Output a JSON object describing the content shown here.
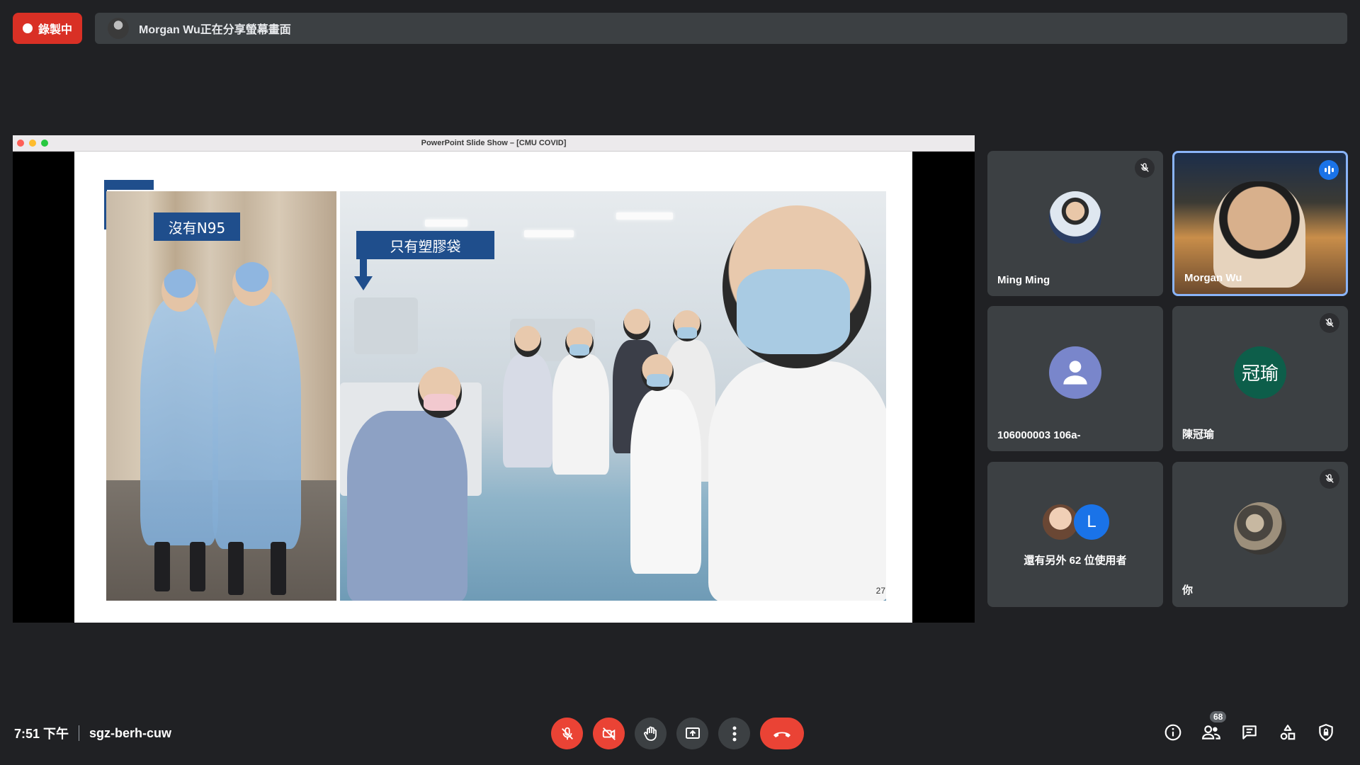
{
  "recording": {
    "label": "錄製中"
  },
  "share_banner": {
    "text": "Morgan Wu正在分享螢幕畫面"
  },
  "presentation": {
    "window_title": "PowerPoint Slide Show – [CMU COVID]",
    "slide": {
      "label_left": "沒有N95",
      "label_right": "只有塑膠袋",
      "page_number": "27"
    }
  },
  "participants": [
    {
      "name": "Ming Ming",
      "muted": true,
      "speaking": false,
      "avatar": "photo"
    },
    {
      "name": "Morgan Wu",
      "muted": false,
      "speaking": true,
      "avatar": "video"
    },
    {
      "name": "106000003 106a-",
      "muted": false,
      "speaking": false,
      "avatar": "default-person-icon",
      "avatar_color": "#7986cb"
    },
    {
      "name": "陳冠瑜",
      "muted": true,
      "speaking": false,
      "avatar_text": "冠瑜",
      "avatar_color": "#0d5e4a"
    },
    {
      "name": "還有另外 62 位使用者",
      "muted": false,
      "speaking": false,
      "avatar": "group",
      "extra_letter": "L",
      "extra_color": "#1a73e8"
    },
    {
      "name": "你",
      "muted": true,
      "speaking": false,
      "avatar": "photo"
    }
  ],
  "meeting": {
    "time": "7:51 下午",
    "code": "sgz-berh-cuw"
  },
  "controls": [
    {
      "name": "mic-off-icon",
      "state": "off"
    },
    {
      "name": "camera-off-icon",
      "state": "off"
    },
    {
      "name": "raise-hand-icon"
    },
    {
      "name": "present-screen-icon"
    },
    {
      "name": "more-options-icon"
    },
    {
      "name": "end-call-icon"
    }
  ],
  "side_panel": {
    "people_count": "68"
  },
  "colors": {
    "background": "#202124",
    "tile": "#3c4043",
    "danger": "#ea4335",
    "accent": "#8ab4f8"
  }
}
